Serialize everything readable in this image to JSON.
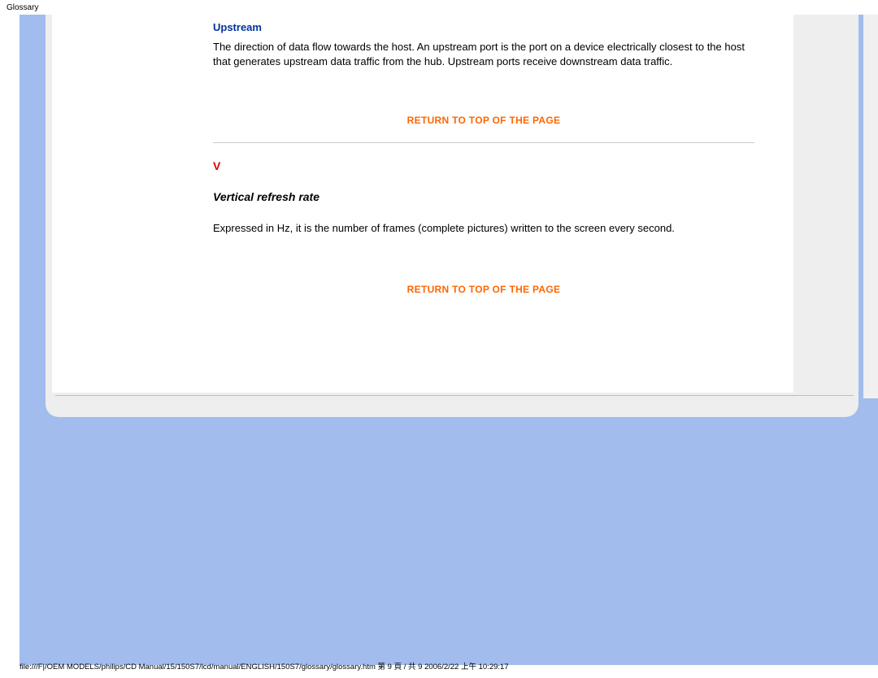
{
  "header": {
    "label": "Glossary"
  },
  "entries": {
    "upstream": {
      "title": "Upstream",
      "description": "The direction of data flow towards the host. An upstream port is the port on a device electrically closest to the host that generates upstream data traffic from the hub. Upstream ports receive downstream data traffic."
    },
    "sectionLetter": "V",
    "vertical": {
      "title": "Vertical refresh rate",
      "description": "Expressed in Hz, it is the number of frames (complete pictures) written to the screen every second."
    }
  },
  "links": {
    "returnTop": "RETURN TO TOP OF THE PAGE"
  },
  "footer": {
    "path": "file:///F|/OEM MODELS/philips/CD Manual/15/150S7/lcd/manual/ENGLISH/150S7/glossary/glossary.htm 第 9 頁 / 共 9 2006/2/22 上午 10:29:17"
  }
}
